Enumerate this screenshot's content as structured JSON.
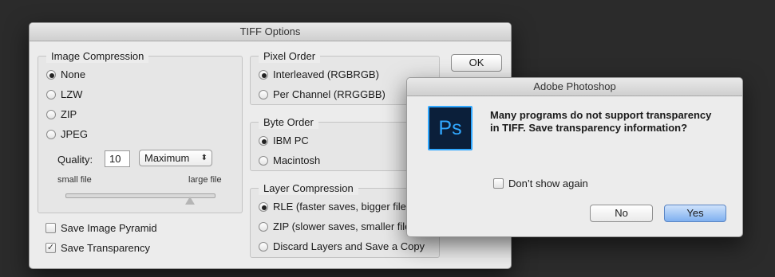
{
  "tiff": {
    "title": "TIFF Options",
    "ok_label": "OK",
    "image_compression": {
      "title": "Image Compression",
      "options": [
        "None",
        "LZW",
        "ZIP",
        "JPEG"
      ],
      "selected": "None",
      "quality_label": "Quality:",
      "quality_value": "10",
      "quality_preset": "Maximum",
      "small_label": "small file",
      "large_label": "large file"
    },
    "pixel_order": {
      "title": "Pixel Order",
      "options": [
        "Interleaved (RGBRGB)",
        "Per Channel (RRGGBB)"
      ],
      "selected": "Interleaved (RGBRGB)"
    },
    "byte_order": {
      "title": "Byte Order",
      "options": [
        "IBM PC",
        "Macintosh"
      ],
      "selected": "IBM PC"
    },
    "layer_compression": {
      "title": "Layer Compression",
      "options": [
        "RLE (faster saves, bigger files)",
        "ZIP (slower saves, smaller files)",
        "Discard Layers and Save a Copy"
      ],
      "selected": "RLE (faster saves, bigger files)"
    },
    "save_pyramid": {
      "label": "Save Image Pyramid",
      "checked": false
    },
    "save_transparency": {
      "label": "Save Transparency",
      "checked": true
    }
  },
  "alert": {
    "title": "Adobe Photoshop",
    "icon_text": "Ps",
    "message": "Many programs do not support transparency in TIFF.  Save transparency information?",
    "dont_show": {
      "label": "Don’t show again",
      "checked": false
    },
    "no_label": "No",
    "yes_label": "Yes"
  },
  "colors": {
    "background": "#2b2b2b",
    "dialog": "#ececec",
    "ps_icon_bg": "#0b1f3a",
    "ps_icon_accent": "#31a8ff",
    "default_button": "#7fb0f0"
  }
}
